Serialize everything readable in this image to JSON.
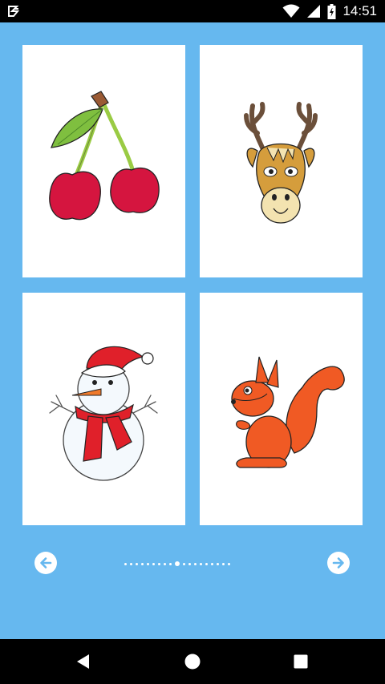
{
  "status_bar": {
    "time": "14:51",
    "icons": [
      "notification-app-icon",
      "wifi-icon",
      "signal-icon",
      "battery-icon"
    ]
  },
  "gallery": {
    "cards": [
      {
        "subject": "cherry"
      },
      {
        "subject": "deer"
      },
      {
        "subject": "snowman"
      },
      {
        "subject": "squirrel"
      }
    ]
  },
  "pager": {
    "prev_icon": "arrow-left-icon",
    "next_icon": "arrow-right-icon",
    "total_pages": 19,
    "current_page": 9
  },
  "navigation_bar": {
    "buttons": [
      "back-icon",
      "home-icon",
      "recents-icon"
    ]
  },
  "colors": {
    "background": "#66b8ef",
    "card": "#ffffff",
    "bars": "#000000"
  }
}
